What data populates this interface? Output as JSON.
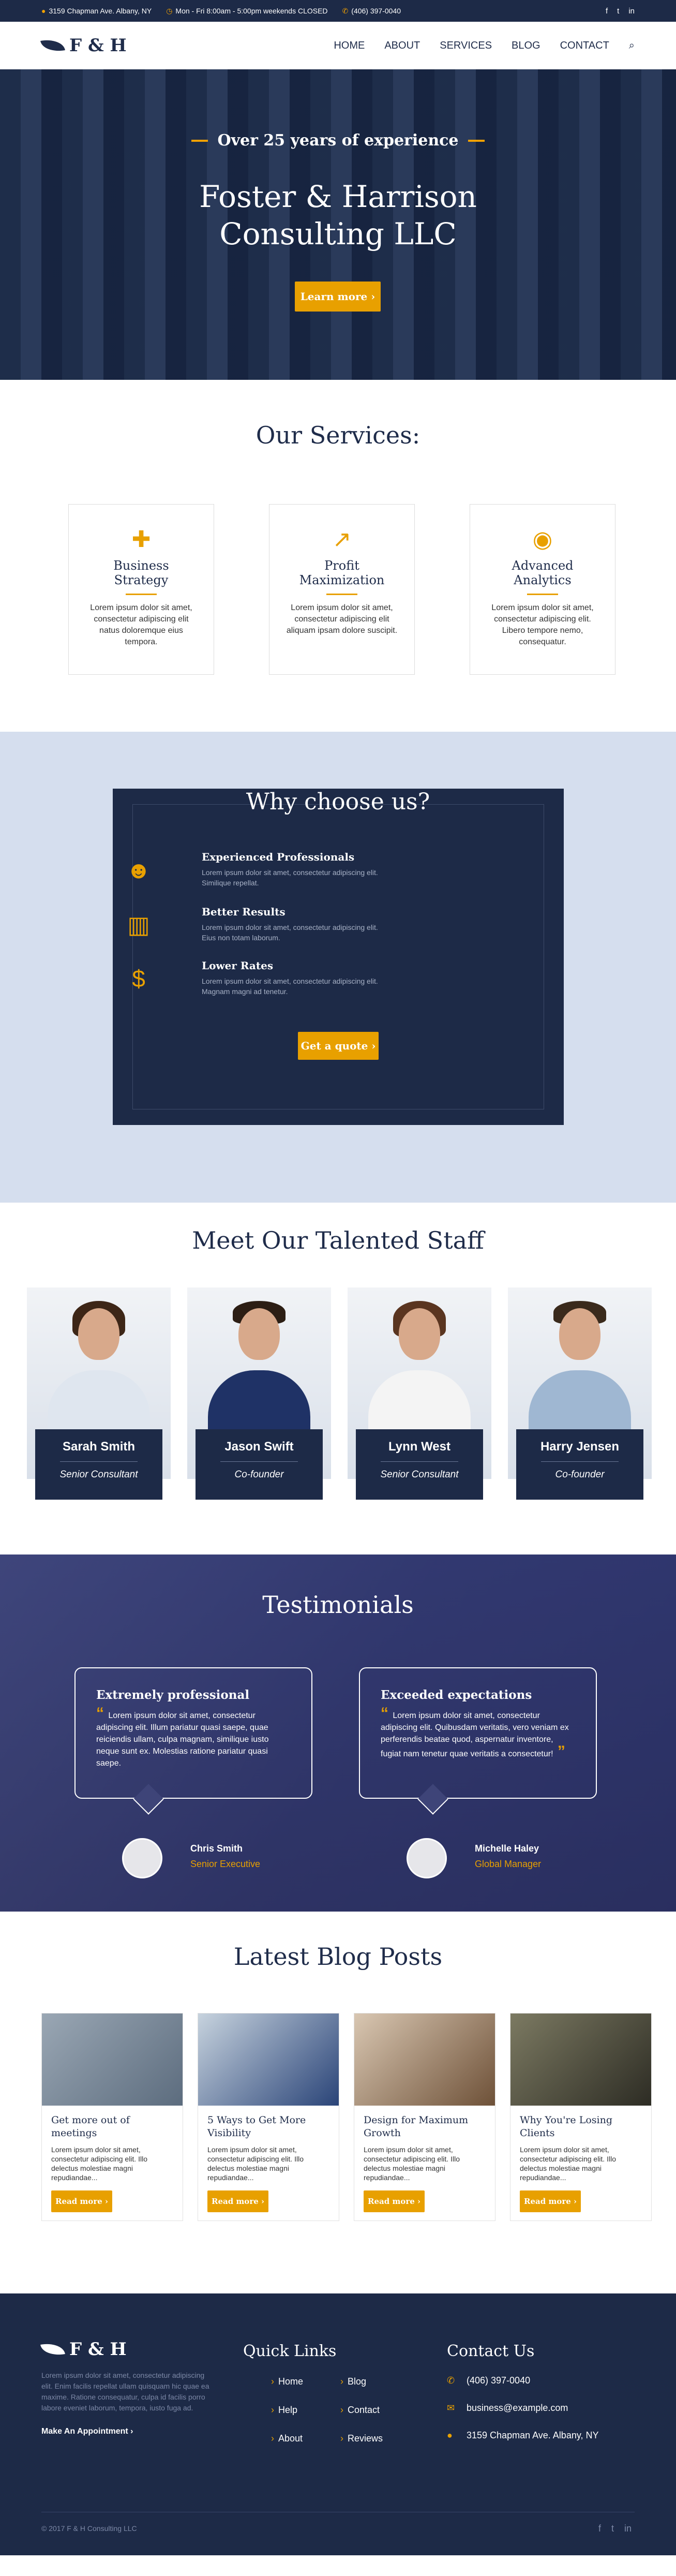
{
  "topbar": {
    "address": "3159 Chapman Ave. Albany, NY",
    "hours": "Mon - Fri 8:00am - 5:00pm weekends CLOSED",
    "phone": "(406) 397-0040",
    "social": [
      "f",
      "t",
      "in"
    ]
  },
  "brand": {
    "logo_text": "F & H"
  },
  "nav": {
    "items": [
      "HOME",
      "ABOUT",
      "SERVICES",
      "BLOG",
      "CONTACT"
    ],
    "search_icon": "search-icon"
  },
  "hero": {
    "tagline": "Over 25 years of experience",
    "title_line1": "Foster & Harrison",
    "title_line2": "Consulting LLC",
    "button": "Learn more ›"
  },
  "services": {
    "title": "Our Services:",
    "cards": [
      {
        "icon": "puzzle-icon",
        "title_line1": "Business",
        "title_line2": "Strategy",
        "text": "Lorem ipsum dolor sit amet, consectetur adipiscing elit natus doloremque eius tempora."
      },
      {
        "icon": "chart-line-icon",
        "title_line1": "Profit",
        "title_line2": "Maximization",
        "text": "Lorem ipsum dolor sit amet, consectetur adipiscing elit aliquam ipsam dolore suscipit."
      },
      {
        "icon": "eye-icon",
        "title_line1": "Advanced",
        "title_line2": "Analytics",
        "text": "Lorem ipsum dolor sit amet, consectetur adipiscing elit. Libero tempore nemo, consequatur."
      }
    ]
  },
  "why": {
    "title": "Why choose us?",
    "items": [
      {
        "icon": "users-icon",
        "title": "Experienced Professionals",
        "text": "Lorem ipsum dolor sit amet, consectetur adipiscing elit. Similique repellat."
      },
      {
        "icon": "bar-chart-icon",
        "title": "Better Results",
        "text": "Lorem ipsum dolor sit amet, consectetur adipiscing elit. Eius non totam laborum."
      },
      {
        "icon": "dollar-icon",
        "title": "Lower Rates",
        "text": "Lorem ipsum dolor sit amet, consectetur adipiscing elit. Magnam magni ad tenetur."
      }
    ],
    "button": "Get a quote ›"
  },
  "staff": {
    "title": "Meet Our Talented Staff",
    "people": [
      {
        "name": "Sarah Smith",
        "role": "Senior Consultant"
      },
      {
        "name": "Jason Swift",
        "role": "Co-founder"
      },
      {
        "name": "Lynn West",
        "role": "Senior Consultant"
      },
      {
        "name": "Harry Jensen",
        "role": "Co-founder"
      }
    ]
  },
  "testimonials": {
    "title": "Testimonials",
    "items": [
      {
        "heading": "Extremely professional",
        "text": "Lorem ipsum dolor sit amet, consectetur adipiscing elit. Illum pariatur quasi saepe, quae reiciendis ullam, culpa magnam, similique iusto neque sunt ex. Molestias ratione pariatur quasi saepe.",
        "name": "Chris Smith",
        "role": "Senior Executive"
      },
      {
        "heading": "Exceeded expectations",
        "text": "Lorem ipsum dolor sit amet, consectetur adipiscing elit. Quibusdam veritatis, vero veniam ex perferendis beatae quod, aspernatur inventore, fugiat nam tenetur quae veritatis a consectetur!",
        "name": "Michelle Haley",
        "role": "Global Manager"
      }
    ]
  },
  "blog": {
    "title": "Latest Blog Posts",
    "posts": [
      {
        "title": "Get more out of meetings",
        "text": "Lorem ipsum dolor sit amet, consectetur adipiscing elit. Illo delectus molestiae magni repudiandae...",
        "button": "Read more ›"
      },
      {
        "title": "5 Ways to Get More Visibility",
        "text": "Lorem ipsum dolor sit amet, consectetur adipiscing elit. Illo delectus molestiae magni repudiandae...",
        "button": "Read more ›"
      },
      {
        "title": "Design for Maximum Growth",
        "text": "Lorem ipsum dolor sit amet, consectetur adipiscing elit. Illo delectus molestiae magni repudiandae...",
        "button": "Read more ›"
      },
      {
        "title": "Why You're Losing Clients",
        "text": "Lorem ipsum dolor sit amet, consectetur adipiscing elit. Illo delectus molestiae magni repudiandae...",
        "button": "Read more ›"
      }
    ]
  },
  "footer": {
    "about": "Lorem ipsum dolor sit amet, consectetur adipiscing elit. Enim facilis repellat ullam quisquam hic quae ea maxime. Ratione consequatur, culpa id facilis porro labore eveniet laborum, tempora, iusto fuga ad.",
    "appointment": "Make An Appointment ›",
    "quick_links_title": "Quick Links",
    "links": [
      "Home",
      "Blog",
      "Help",
      "Contact",
      "About",
      "Reviews"
    ],
    "contact_title": "Contact Us",
    "phone": "(406) 397-0040",
    "email": "business@example.com",
    "address": "3159 Chapman Ave. Albany, NY",
    "copyright": "© 2017 F & H Consulting LLC"
  },
  "colors": {
    "navy": "#1d2a47",
    "accent": "#e8a000",
    "light_blue": "#d5deee"
  }
}
